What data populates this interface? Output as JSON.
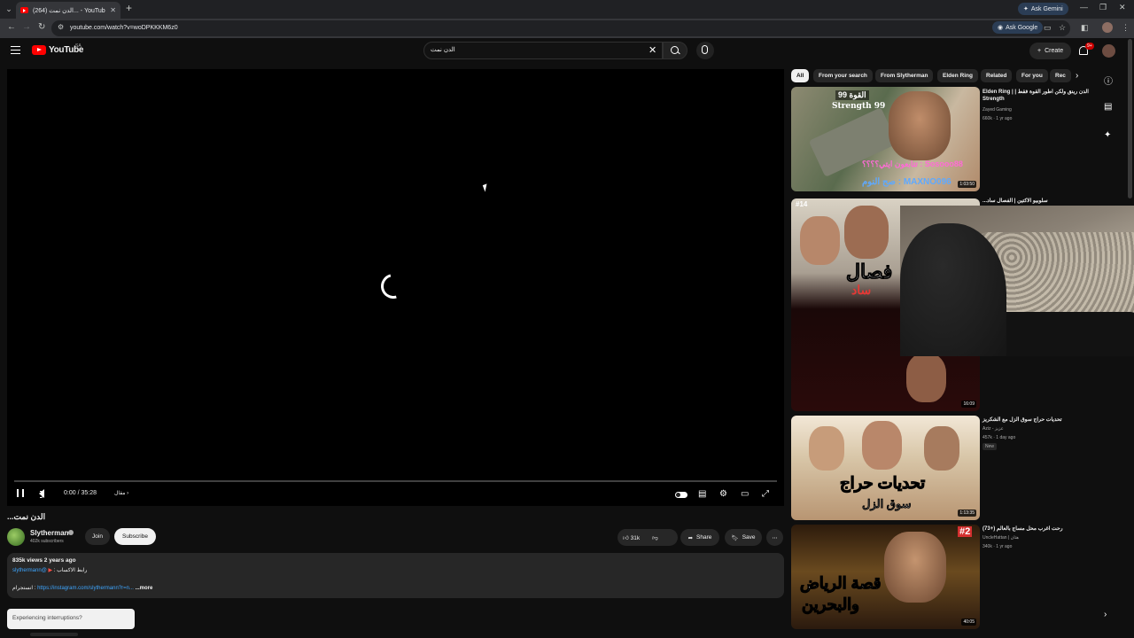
{
  "browser": {
    "tab_title": "(264) الدن نمت... - YouTube",
    "url": "youtube.com/watch?v=woDPKKKM6z0",
    "ask_gemini": "Ask Gemini",
    "ask_google": "Ask Google"
  },
  "masthead": {
    "logo_text": "YouTube",
    "country": "SA",
    "search_value": "الدن نمت",
    "create_label": "Create",
    "notification_count": "9+"
  },
  "player": {
    "time": "0:00 / 35:28",
    "chapter": "مقال"
  },
  "video": {
    "title": "الدن نمت...",
    "channel": "Slytherman",
    "subscribers": "402k subscribers",
    "join_label": "Join",
    "subscribe_label": "Subscribe",
    "likes": "31k",
    "share_label": "Share",
    "save_label": "Save",
    "meta": "835k views  2 years ago",
    "desc_line1_prefix": "رابط الاكساب :",
    "desc_line1_handle": "@slythermann",
    "desc_line2_prefix": "انستجرام :",
    "desc_line2_link": "https://instagram.com/slythermann?r=n...",
    "more_label": "...more",
    "interruption_prompt": "Experiencing interruptions?"
  },
  "chips": [
    "All",
    "From your search",
    "From Slytherman",
    "Elden Ring",
    "Related",
    "For you",
    "Rec"
  ],
  "recommendations": [
    {
      "title": "الدن رينق ولكن اطور القوة فقط | Elden Ring | Strength",
      "channel": "Zayed Gaming",
      "stats": "660k · 1 yr ago",
      "duration": "1:03:50",
      "overlay_1": "القوة 99",
      "overlay_2": "Strength 99",
      "overlay_3": "Sosooo88 : تتابعون ايتي؟؟؟؟",
      "overlay_4": "MAXNO096 : صح النوم"
    },
    {
      "title": "سلوبيو الاكتين | الفصال ساد...",
      "channel": "",
      "stats": "",
      "duration": "16:09",
      "overlay_1": "#14",
      "overlay_2": "فصال",
      "overlay_3": "ساد"
    },
    {
      "title": "تحديات حراج سوق الزل مع الشكريز",
      "channel": "Aziz - عزيز",
      "stats": "457k · 1 day ago",
      "badge": "New",
      "duration": "1:13:35",
      "overlay_1": "تحديات حراج",
      "overlay_2": "سوق الزل"
    },
    {
      "title": "رحت اغرب محل مساج بالعالم (+73)",
      "channel": "UncleHattan | هتان",
      "stats": "340k · 1 yr ago",
      "duration": "40:05",
      "overlay_1": "#2",
      "overlay_2": "قصة الرياض",
      "overlay_3": "والبحرين"
    }
  ]
}
